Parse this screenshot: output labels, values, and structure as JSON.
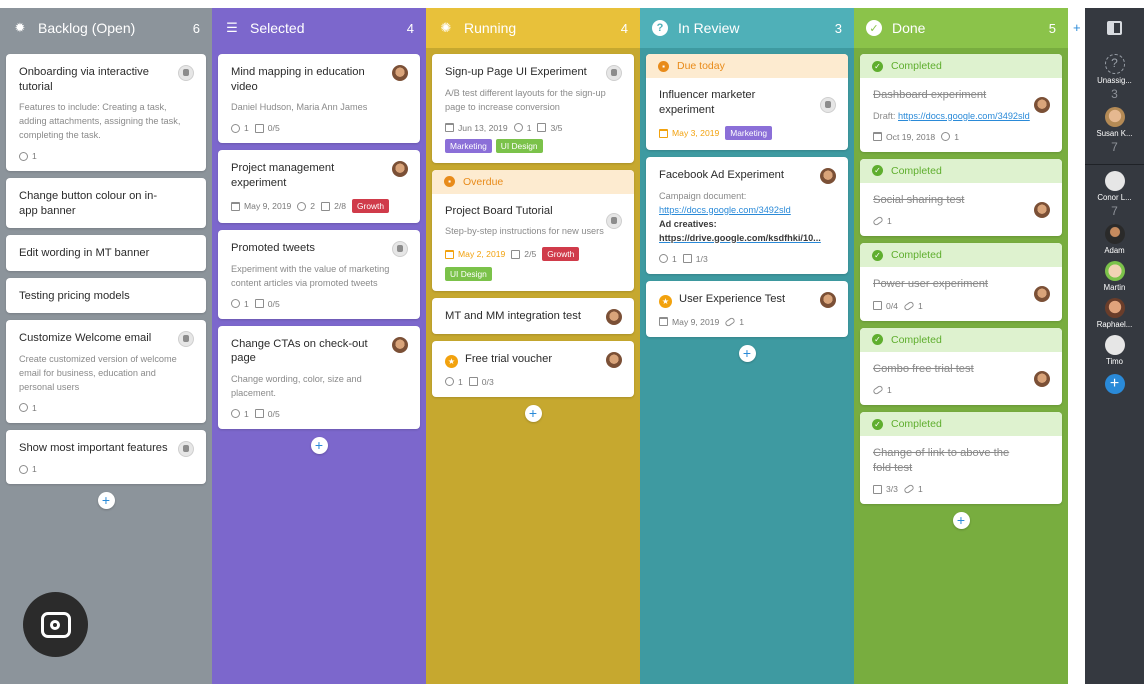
{
  "columns": [
    {
      "id": "backlog",
      "title": "Backlog (Open)",
      "count": "6",
      "color": "#8c949b",
      "icon": "bulb-icon",
      "add": "+",
      "cards": [
        {
          "title": "Onboarding via interactive tutorial",
          "desc": "Features to include: Creating a task, adding attachments, assigning the task, completing the task.",
          "avatar": "bot",
          "meta": [
            {
              "icon": "comment-icon",
              "text": "1"
            }
          ]
        },
        {
          "title": "Change button colour on in-app banner"
        },
        {
          "title": "Edit wording in MT banner"
        },
        {
          "title": "Testing pricing models"
        },
        {
          "title": "Customize Welcome email",
          "desc": "Create customized version of welcome email for business, education and personal users",
          "avatar": "bot",
          "meta": [
            {
              "icon": "comment-icon",
              "text": "1"
            }
          ]
        },
        {
          "title": "Show most important features",
          "avatar": "bot",
          "meta": [
            {
              "icon": "comment-icon",
              "text": "1"
            }
          ]
        }
      ]
    },
    {
      "id": "selected",
      "title": "Selected",
      "count": "4",
      "color": "#7c67cc",
      "icon": "stack-icon",
      "add": "+",
      "cards": [
        {
          "title": "Mind mapping in education video",
          "desc": "Daniel Hudson, Maria Ann James",
          "avatar": "face",
          "meta": [
            {
              "icon": "comment-icon",
              "text": "1"
            },
            {
              "icon": "checklist-icon",
              "text": "0/5"
            }
          ]
        },
        {
          "title": "Project management experiment",
          "avatar": "face",
          "meta": [
            {
              "icon": "calendar-icon",
              "text": "May 9, 2019"
            },
            {
              "icon": "comment-icon",
              "text": "2"
            },
            {
              "icon": "checklist-icon",
              "text": "2/8"
            }
          ],
          "tags": [
            {
              "label": "Growth",
              "color": "#d03b4a"
            }
          ],
          "inline_tags": true
        },
        {
          "title": "Promoted tweets",
          "desc": "Experiment with the value of marketing content articles via promoted tweets",
          "avatar": "bot",
          "meta": [
            {
              "icon": "comment-icon",
              "text": "1"
            },
            {
              "icon": "checklist-icon",
              "text": "0/5"
            }
          ]
        },
        {
          "title": "Change CTAs on check-out page",
          "desc": "Change wording, color, size and placement.",
          "avatar": "face",
          "meta": [
            {
              "icon": "comment-icon",
              "text": "1"
            },
            {
              "icon": "checklist-icon",
              "text": "0/5"
            }
          ]
        }
      ]
    },
    {
      "id": "running",
      "title": "Running",
      "count": "4",
      "color": "#e8c13a",
      "body_color": "#c6a82f",
      "icon": "gear-icon",
      "add": "+",
      "cards": [
        {
          "title": "Sign-up Page UI Experiment",
          "desc": "A/B test different layouts for the sign-up page to increase conversion",
          "avatar": "bot",
          "meta": [
            {
              "icon": "calendar-icon",
              "text": "Jun 13, 2019"
            },
            {
              "icon": "comment-icon",
              "text": "1"
            },
            {
              "icon": "checklist-icon",
              "text": "3/5"
            }
          ],
          "tags": [
            {
              "label": "Marketing",
              "color": "#8b6fd8"
            },
            {
              "label": "UI Design",
              "color": "#7bc24a"
            }
          ]
        },
        {
          "band": {
            "label": "Overdue",
            "bg": "#fdebd0",
            "fg": "#e88b1a",
            "icon": "overdue-icon"
          },
          "title": "Project Board Tutorial",
          "desc": "Step-by-step instructions for new users",
          "avatar": "bot",
          "meta": [
            {
              "icon": "calendar-icon",
              "text": "May 2, 2019",
              "warn": true
            },
            {
              "icon": "checklist-icon",
              "text": "2/5"
            }
          ],
          "tags": [
            {
              "label": "Growth",
              "color": "#d03b4a"
            }
          ],
          "inline_tags": true,
          "tags2": [
            {
              "label": "UI Design",
              "color": "#7bc24a"
            }
          ]
        },
        {
          "title": "MT and MM integration test",
          "avatar": "face"
        },
        {
          "title": "Free trial voucher",
          "star": true,
          "avatar": "face",
          "meta": [
            {
              "icon": "comment-icon",
              "text": "1"
            },
            {
              "icon": "checklist-icon",
              "text": "0/3"
            }
          ]
        }
      ]
    },
    {
      "id": "review",
      "title": "In Review",
      "count": "3",
      "color": "#4fb0b8",
      "body_color": "#3e9aa1",
      "icon": "question-icon",
      "add": "+",
      "cards": [
        {
          "band": {
            "label": "Due today",
            "bg": "#fdebd0",
            "fg": "#e88b1a",
            "icon": "due-icon"
          },
          "title": "Influencer marketer experiment",
          "avatar": "bot",
          "meta": [
            {
              "icon": "calendar-icon",
              "text": "May 3, 2019",
              "warn": true
            }
          ],
          "tags": [
            {
              "label": "Marketing",
              "color": "#8b6fd8"
            }
          ],
          "inline_tags": true
        },
        {
          "title": "Facebook Ad Experiment",
          "desc_html": "Campaign document:<br><a>https://docs.google.com/3492sld</a><br><b>Ad creatives:</b><br><a><b>https://drive.google.com/ksdfhki/10...</b></a>",
          "avatar": "face",
          "meta": [
            {
              "icon": "comment-icon",
              "text": "1"
            },
            {
              "icon": "checklist-icon",
              "text": "1/3"
            }
          ]
        },
        {
          "title": "User Experience Test",
          "star": true,
          "avatar": "face",
          "meta": [
            {
              "icon": "calendar-icon",
              "text": "May 9, 2019"
            },
            {
              "icon": "link-icon",
              "text": "1"
            }
          ]
        }
      ]
    },
    {
      "id": "done",
      "title": "Done",
      "count": "5",
      "color": "#8bc34a",
      "body_color": "#78ad3f",
      "icon": "check-icon",
      "add": "+",
      "cards": [
        {
          "band": {
            "label": "Completed",
            "bg": "#def2cf",
            "fg": "#5fae2e",
            "icon": "completed-icon"
          },
          "title": "Dashboard experiment",
          "strike": true,
          "desc_html": "Draft: <a>https://docs.google.com/3492sld</a>",
          "avatar": "face",
          "meta": [
            {
              "icon": "calendar-icon",
              "text": "Oct 19, 2018"
            },
            {
              "icon": "comment-icon",
              "text": "1"
            }
          ]
        },
        {
          "band": {
            "label": "Completed",
            "bg": "#def2cf",
            "fg": "#5fae2e",
            "icon": "completed-icon"
          },
          "title": "Social sharing test",
          "strike": true,
          "avatar": "face",
          "meta": [
            {
              "icon": "link-icon",
              "text": "1"
            }
          ]
        },
        {
          "band": {
            "label": "Completed",
            "bg": "#def2cf",
            "fg": "#5fae2e",
            "icon": "completed-icon"
          },
          "title": "Power user experiment",
          "strike": true,
          "avatar": "face",
          "meta": [
            {
              "icon": "checklist-icon",
              "text": "0/4"
            },
            {
              "icon": "link-icon",
              "text": "1"
            }
          ]
        },
        {
          "band": {
            "label": "Completed",
            "bg": "#def2cf",
            "fg": "#5fae2e",
            "icon": "completed-icon"
          },
          "title": "Combo free trial test",
          "strike": true,
          "avatar": "face",
          "meta": [
            {
              "icon": "link-icon",
              "text": "1"
            }
          ]
        },
        {
          "band": {
            "label": "Completed",
            "bg": "#def2cf",
            "fg": "#5fae2e",
            "icon": "completed-icon"
          },
          "title": "Change of link to above the fold test",
          "strike": true,
          "meta": [
            {
              "icon": "checklist-icon",
              "text": "3/3"
            },
            {
              "icon": "link-icon",
              "text": "1"
            }
          ]
        }
      ]
    }
  ],
  "rightbar": {
    "add_column": "+",
    "users": [
      {
        "name": "Unassig...",
        "count": "3",
        "avatar": "unassigned"
      },
      {
        "name": "Susan K...",
        "count": "7",
        "avatar": "face"
      },
      {
        "name": "Conor L...",
        "count": "7",
        "avatar": "bot"
      },
      {
        "name": "Adam",
        "avatar": "dark"
      },
      {
        "name": "Martin",
        "avatar": "glasses"
      },
      {
        "name": "Raphael...",
        "avatar": "face2"
      },
      {
        "name": "Timo",
        "avatar": "bot"
      }
    ],
    "add_user": "+"
  },
  "overlay": {
    "icon": "lens-camera-icon"
  }
}
